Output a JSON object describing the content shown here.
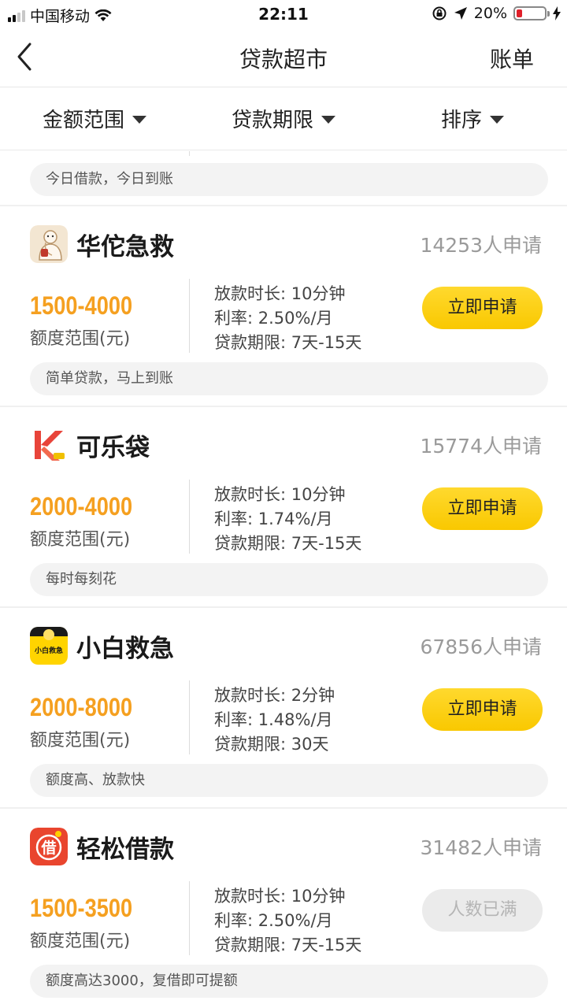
{
  "status_bar": {
    "carrier": "中国移动",
    "time": "22:11",
    "battery": "20%",
    "battery_level": 0.2,
    "battery_color": "#e0202a"
  },
  "nav": {
    "back_icon": "chevron-left-icon",
    "title": "贷款超市",
    "bill": "账单"
  },
  "filters": [
    {
      "label": "金额范围"
    },
    {
      "label": "贷款期限"
    },
    {
      "label": "排序"
    }
  ],
  "prev_tag": "今日借款，今日到账",
  "colors": {
    "accent": "#f9c800",
    "amount": "#f5a020",
    "disabled": "#ebebeb"
  },
  "products": [
    {
      "name": "华佗急救",
      "applicants": "14253人申请",
      "amount": "1500-4000",
      "amount_label": "额度范围(元)",
      "time": "放款时长: 10分钟",
      "rate": "利率: 2.50%/月",
      "term": "贷款期限: 7天-15天",
      "button": "立即申请",
      "tag": "简单贷款，马上到账"
    },
    {
      "name": "可乐袋",
      "applicants": "15774人申请",
      "amount": "2000-4000",
      "amount_label": "额度范围(元)",
      "time": "放款时长: 10分钟",
      "rate": "利率: 1.74%/月",
      "term": "贷款期限: 7天-15天",
      "button": "立即申请",
      "tag": "每时每刻花"
    },
    {
      "name": "小白救急",
      "applicants": "67856人申请",
      "amount": "2000-8000",
      "amount_label": "额度范围(元)",
      "time": "放款时长: 2分钟",
      "rate": "利率: 1.48%/月",
      "term": "贷款期限: 30天",
      "button": "立即申请",
      "tag": "额度高、放款快",
      "logo_text": "小白救急"
    },
    {
      "name": "轻松借款",
      "applicants": "31482人申请",
      "amount": "1500-3500",
      "amount_label": "额度范围(元)",
      "time": "放款时长: 10分钟",
      "rate": "利率: 2.50%/月",
      "term": "贷款期限: 7天-15天",
      "button": "人数已满",
      "tag": "额度高达3000，复借即可提额",
      "logo_text": "借"
    }
  ]
}
